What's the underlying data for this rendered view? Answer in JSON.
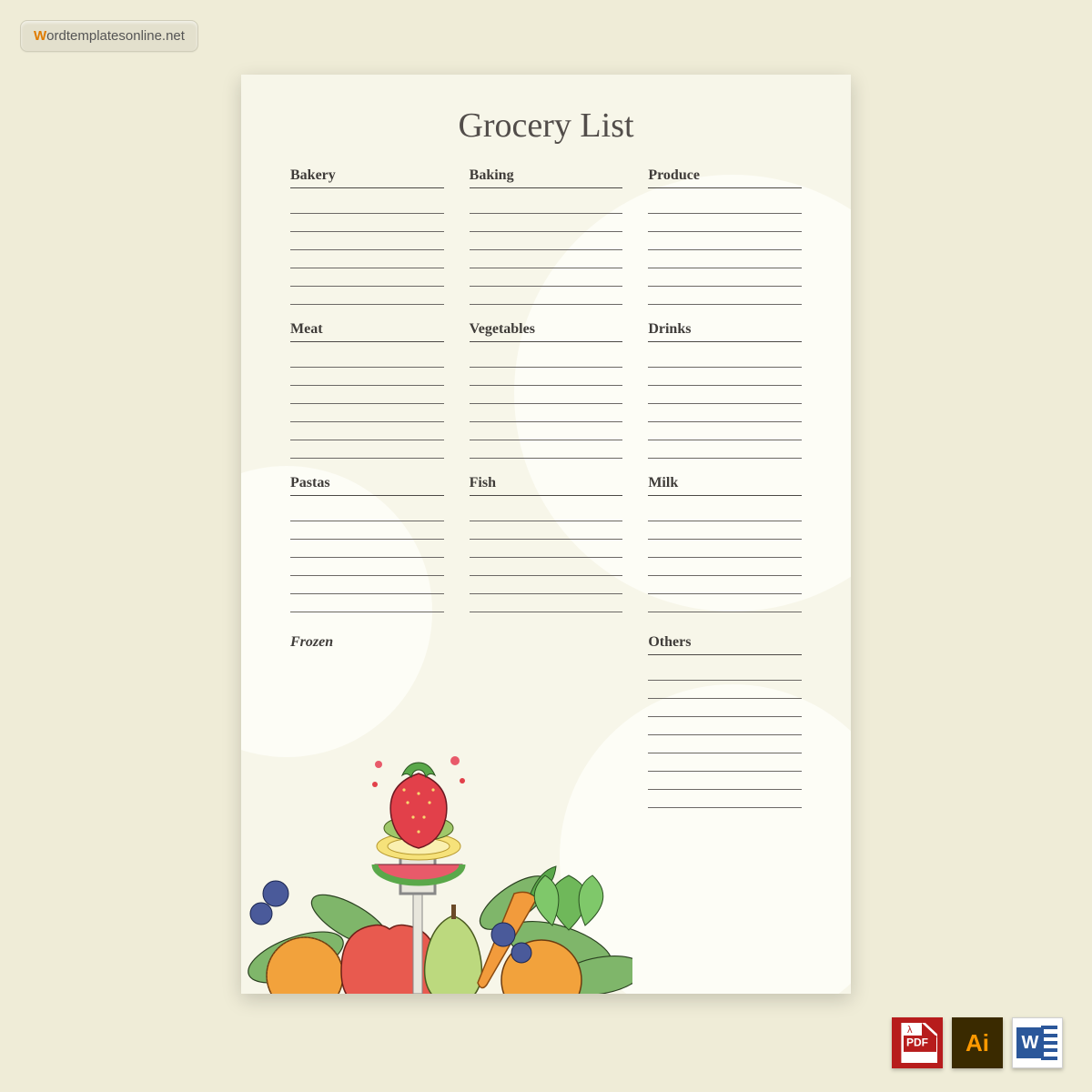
{
  "watermark": {
    "first_letter": "W",
    "rest": "ordtemplatesonline.net"
  },
  "title": "Grocery List",
  "lines_per_section": 6,
  "others_lines": 8,
  "sections_row1": [
    {
      "heading": "Bakery"
    },
    {
      "heading": "Baking"
    },
    {
      "heading": "Produce"
    }
  ],
  "sections_row2": [
    {
      "heading": "Meat"
    },
    {
      "heading": "Vegetables"
    },
    {
      "heading": "Drinks"
    }
  ],
  "sections_row3": [
    {
      "heading": "Pastas"
    },
    {
      "heading": "Fish"
    },
    {
      "heading": "Milk"
    }
  ],
  "sections_row4": [
    {
      "heading": "Frozen"
    },
    {
      "heading": ""
    },
    {
      "heading": "Others"
    }
  ],
  "badges": {
    "pdf": "PDF",
    "pdf_lambda": "λ",
    "ai": "Ai",
    "word": "W"
  }
}
